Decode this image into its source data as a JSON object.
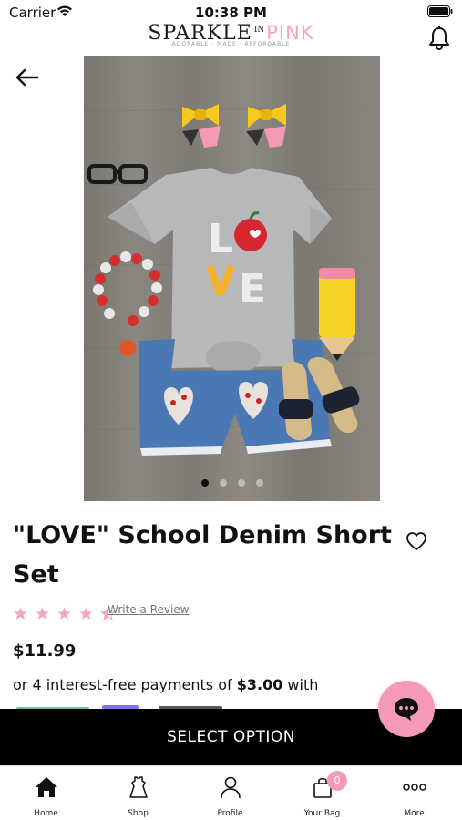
{
  "status_bar": {
    "carrier": "Carrier",
    "time": "10:38 PM"
  },
  "brand": {
    "name_main": "SPARKLE",
    "name_in": "IN",
    "name_pink": "PINK",
    "tagline": "ADORABLE · MADE · AFFORDABLE",
    "pink_color": "#f2a3bf"
  },
  "icons": {
    "back": "arrow-left-icon",
    "notifications": "bell-icon",
    "favorite": "heart-icon",
    "chat": "chat-bubble-icon"
  },
  "product": {
    "title": "\"LOVE\" School Denim Short Set",
    "rating": 4.5,
    "rating_max": 5,
    "write_review_label": "Write a Review",
    "price": "$11.99",
    "installments_prefix": "or 4 interest-free payments of ",
    "installments_amount": "$3.00",
    "installments_suffix": " with",
    "image_count": 4,
    "active_image": 1
  },
  "actions": {
    "select_option_label": "SELECT OPTION"
  },
  "tab_bar": {
    "tabs": [
      {
        "label": "Home",
        "icon": "home-icon"
      },
      {
        "label": "Shop",
        "icon": "dress-icon"
      },
      {
        "label": "Profile",
        "icon": "person-icon"
      },
      {
        "label": "Your Bag",
        "icon": "bag-icon",
        "badge": "0"
      },
      {
        "label": "More",
        "icon": "more-dots-icon"
      }
    ]
  },
  "colors": {
    "accent_pink": "#f49ab8",
    "star_pink": "#f4a6c0"
  }
}
